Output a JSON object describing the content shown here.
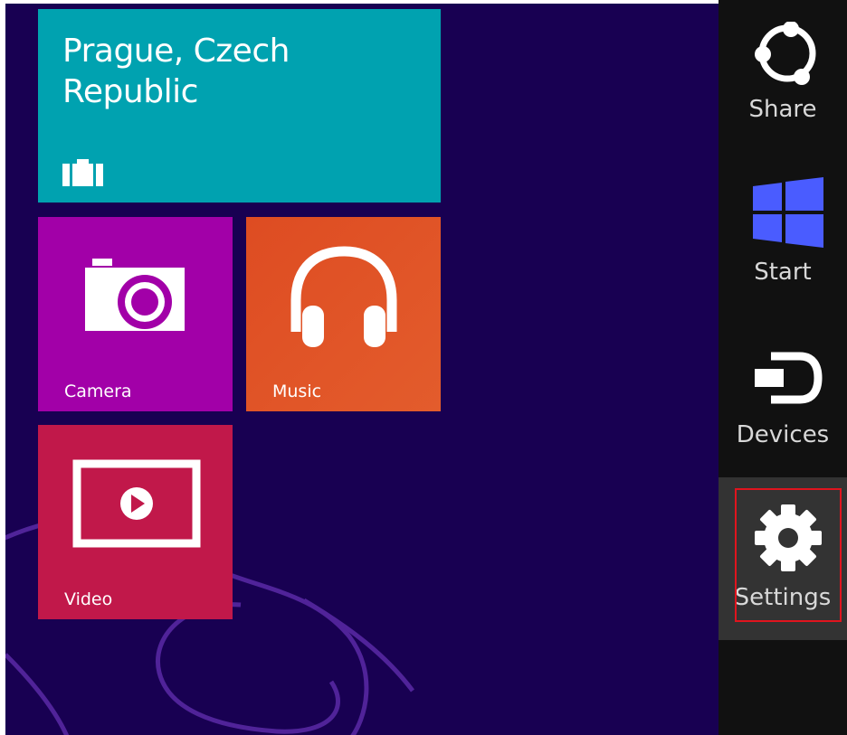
{
  "tiles": {
    "travel": {
      "title": "Prague, Czech Republic",
      "icon": "luggage-icon",
      "color": "#00a2b0"
    },
    "camera": {
      "label": "Camera",
      "icon": "camera-icon",
      "color": "#a200a8"
    },
    "music": {
      "label": "Music",
      "icon": "headphones-icon",
      "color": "#de4c22"
    },
    "video": {
      "label": "Video",
      "icon": "video-play-icon",
      "color": "#c1184a"
    }
  },
  "charms": {
    "share": {
      "label": "Share",
      "icon": "share-icon"
    },
    "start": {
      "label": "Start",
      "icon": "windows-logo-icon",
      "accent": "#4a5cff"
    },
    "devices": {
      "label": "Devices",
      "icon": "devices-icon"
    },
    "settings": {
      "label": "Settings",
      "icon": "gear-icon",
      "highlight": "#e0141e"
    }
  },
  "colors": {
    "start_background": "#180052",
    "charms_background": "#111111",
    "selected_charm": "#333333"
  }
}
